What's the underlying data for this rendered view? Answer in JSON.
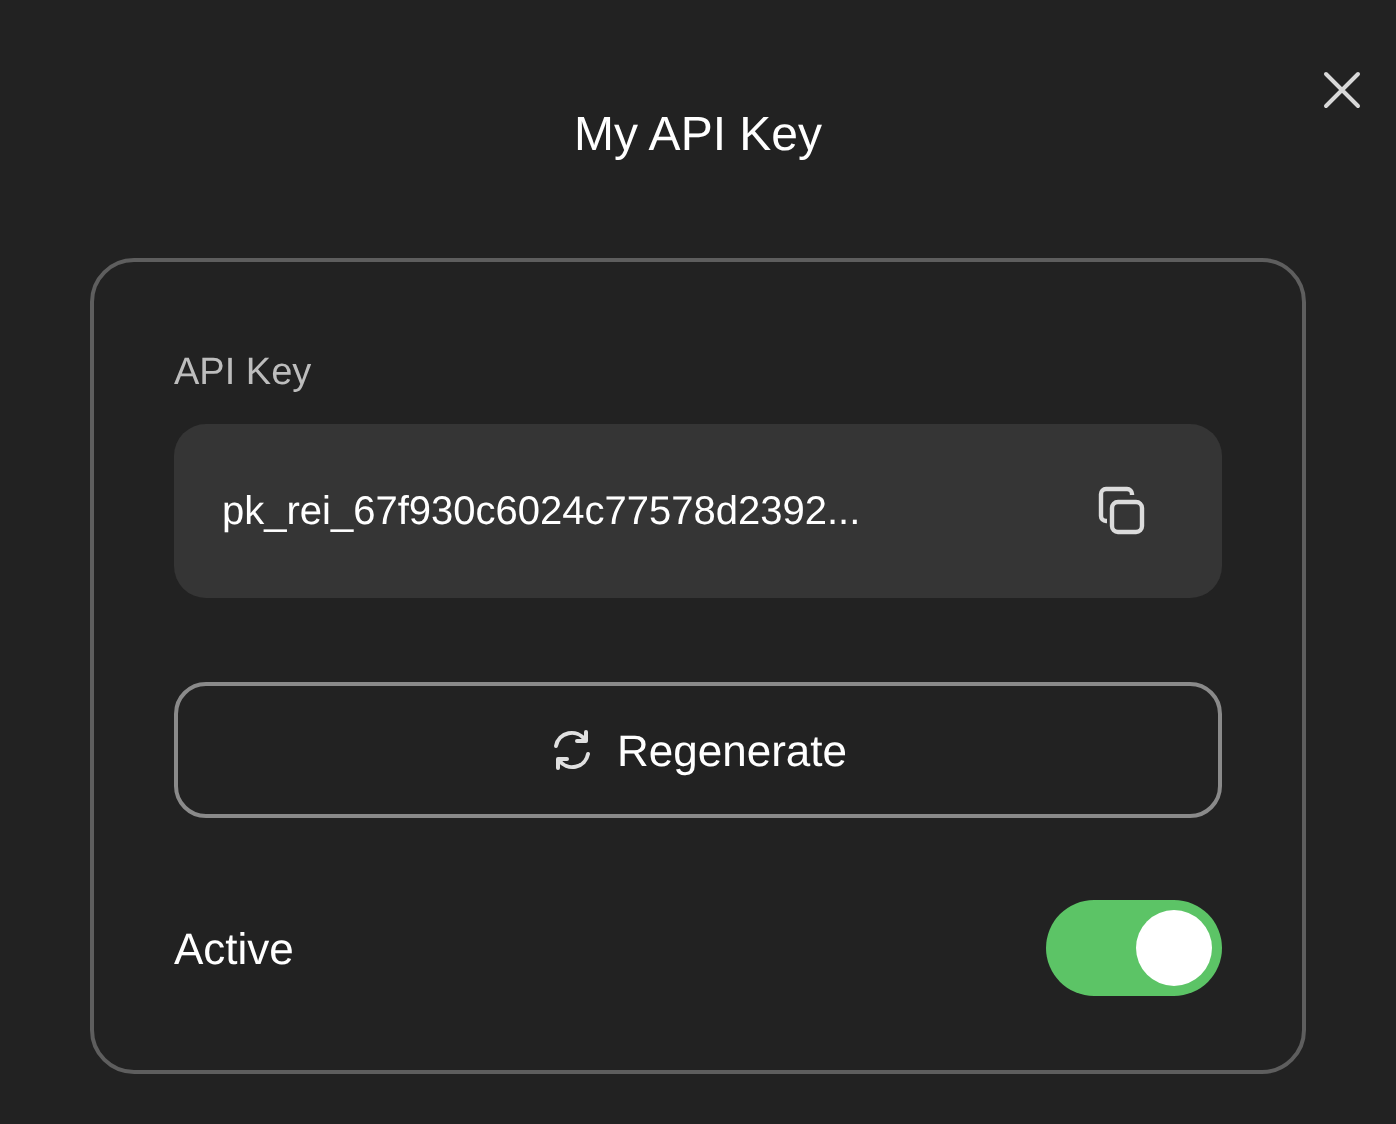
{
  "dialog": {
    "title": "My API Key"
  },
  "api_key": {
    "label": "API Key",
    "value": "pk_rei_67f930c6024c77578d2392..."
  },
  "regenerate_button": {
    "label": "Regenerate"
  },
  "active": {
    "label": "Active",
    "on": true
  }
}
